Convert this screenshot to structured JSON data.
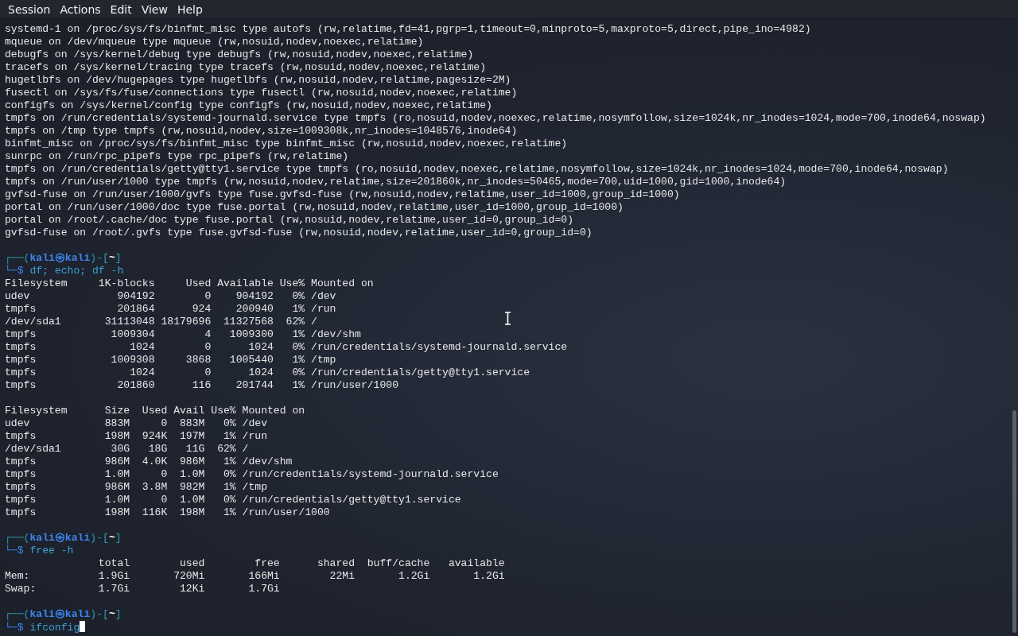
{
  "menu": [
    "Session",
    "Actions",
    "Edit",
    "View",
    "Help"
  ],
  "lines": [
    {
      "kind": "output",
      "text": "systemd-1 on /proc/sys/fs/binfmt_misc type autofs (rw,relatime,fd=41,pgrp=1,timeout=0,minproto=5,maxproto=5,direct,pipe_ino=4982)"
    },
    {
      "kind": "output",
      "text": "mqueue on /dev/mqueue type mqueue (rw,nosuid,nodev,noexec,relatime)"
    },
    {
      "kind": "output",
      "text": "debugfs on /sys/kernel/debug type debugfs (rw,nosuid,nodev,noexec,relatime)"
    },
    {
      "kind": "output",
      "text": "tracefs on /sys/kernel/tracing type tracefs (rw,nosuid,nodev,noexec,relatime)"
    },
    {
      "kind": "output",
      "text": "hugetlbfs on /dev/hugepages type hugetlbfs (rw,nosuid,nodev,relatime,pagesize=2M)"
    },
    {
      "kind": "output",
      "text": "fusectl on /sys/fs/fuse/connections type fusectl (rw,nosuid,nodev,noexec,relatime)"
    },
    {
      "kind": "output",
      "text": "configfs on /sys/kernel/config type configfs (rw,nosuid,nodev,noexec,relatime)"
    },
    {
      "kind": "output",
      "text": "tmpfs on /run/credentials/systemd-journald.service type tmpfs (ro,nosuid,nodev,noexec,relatime,nosymfollow,size=1024k,nr_inodes=1024,mode=700,inode64,noswap)"
    },
    {
      "kind": "output",
      "text": "tmpfs on /tmp type tmpfs (rw,nosuid,nodev,size=1009308k,nr_inodes=1048576,inode64)"
    },
    {
      "kind": "output",
      "text": "binfmt_misc on /proc/sys/fs/binfmt_misc type binfmt_misc (rw,nosuid,nodev,noexec,relatime)"
    },
    {
      "kind": "output",
      "text": "sunrpc on /run/rpc_pipefs type rpc_pipefs (rw,relatime)"
    },
    {
      "kind": "output",
      "text": "tmpfs on /run/credentials/getty@tty1.service type tmpfs (ro,nosuid,nodev,noexec,relatime,nosymfollow,size=1024k,nr_inodes=1024,mode=700,inode64,noswap)"
    },
    {
      "kind": "output",
      "text": "tmpfs on /run/user/1000 type tmpfs (rw,nosuid,nodev,relatime,size=201860k,nr_inodes=50465,mode=700,uid=1000,gid=1000,inode64)"
    },
    {
      "kind": "output",
      "text": "gvfsd-fuse on /run/user/1000/gvfs type fuse.gvfsd-fuse (rw,nosuid,nodev,relatime,user_id=1000,group_id=1000)"
    },
    {
      "kind": "output",
      "text": "portal on /run/user/1000/doc type fuse.portal (rw,nosuid,nodev,relatime,user_id=1000,group_id=1000)"
    },
    {
      "kind": "output",
      "text": "portal on /root/.cache/doc type fuse.portal (rw,nosuid,nodev,relatime,user_id=0,group_id=0)"
    },
    {
      "kind": "output",
      "text": "gvfsd-fuse on /root/.gvfs type fuse.gvfsd-fuse (rw,nosuid,nodev,relatime,user_id=0,group_id=0)"
    },
    {
      "kind": "blank"
    },
    {
      "kind": "prompt",
      "open": "┌──(",
      "user": "kali",
      "at": "㉿",
      "host": "kali",
      "mid": ")-[",
      "cwd": "~",
      "close": "]",
      "symbol": "└─$",
      "command": "df; echo; df -h",
      "cursor": false
    },
    {
      "kind": "output",
      "text": "Filesystem     1K-blocks     Used Available Use% Mounted on"
    },
    {
      "kind": "output",
      "text": "udev              904192        0    904192   0% /dev"
    },
    {
      "kind": "output",
      "text": "tmpfs             201864      924    200940   1% /run"
    },
    {
      "kind": "output",
      "text": "/dev/sda1       31113048 18179696  11327568  62% /"
    },
    {
      "kind": "output",
      "text": "tmpfs            1009304        4   1009300   1% /dev/shm"
    },
    {
      "kind": "output",
      "text": "tmpfs               1024        0      1024   0% /run/credentials/systemd-journald.service"
    },
    {
      "kind": "output",
      "text": "tmpfs            1009308     3868   1005440   1% /tmp"
    },
    {
      "kind": "output",
      "text": "tmpfs               1024        0      1024   0% /run/credentials/getty@tty1.service"
    },
    {
      "kind": "output",
      "text": "tmpfs             201860      116    201744   1% /run/user/1000"
    },
    {
      "kind": "blank"
    },
    {
      "kind": "output",
      "text": "Filesystem      Size  Used Avail Use% Mounted on"
    },
    {
      "kind": "output",
      "text": "udev            883M     0  883M   0% /dev"
    },
    {
      "kind": "output",
      "text": "tmpfs           198M  924K  197M   1% /run"
    },
    {
      "kind": "output",
      "text": "/dev/sda1        30G   18G   11G  62% /"
    },
    {
      "kind": "output",
      "text": "tmpfs           986M  4.0K  986M   1% /dev/shm"
    },
    {
      "kind": "output",
      "text": "tmpfs           1.0M     0  1.0M   0% /run/credentials/systemd-journald.service"
    },
    {
      "kind": "output",
      "text": "tmpfs           986M  3.8M  982M   1% /tmp"
    },
    {
      "kind": "output",
      "text": "tmpfs           1.0M     0  1.0M   0% /run/credentials/getty@tty1.service"
    },
    {
      "kind": "output",
      "text": "tmpfs           198M  116K  198M   1% /run/user/1000"
    },
    {
      "kind": "blank"
    },
    {
      "kind": "prompt",
      "open": "┌──(",
      "user": "kali",
      "at": "㉿",
      "host": "kali",
      "mid": ")-[",
      "cwd": "~",
      "close": "]",
      "symbol": "└─$",
      "command": "free -h",
      "cursor": false
    },
    {
      "kind": "output",
      "text": "               total        used        free      shared  buff/cache   available"
    },
    {
      "kind": "output",
      "text": "Mem:           1.9Gi       720Mi       166Mi        22Mi       1.2Gi       1.2Gi"
    },
    {
      "kind": "output",
      "text": "Swap:          1.7Gi        12Ki       1.7Gi"
    },
    {
      "kind": "blank"
    },
    {
      "kind": "prompt",
      "open": "┌──(",
      "user": "kali",
      "at": "㉿",
      "host": "kali",
      "mid": ")-[",
      "cwd": "~",
      "close": "]",
      "symbol": "└─$",
      "command": "ifconfig",
      "cursor": true
    }
  ]
}
